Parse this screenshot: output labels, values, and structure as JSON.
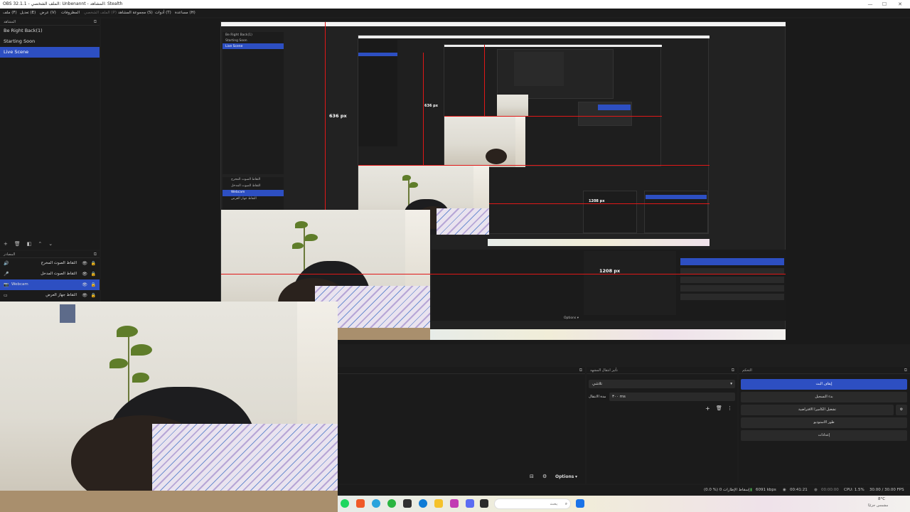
{
  "window": {
    "title": "OBS 32.1.1 - الملف الشخصي: Unbenannt - المشاهد: Stealth",
    "minimize": "—",
    "maximize": "☐",
    "close": "✕"
  },
  "menu": {
    "items": [
      "ملف (F)",
      "تعديل (E)",
      "عرض (V)",
      "المظروفات",
      "الملف الشخصي (P)",
      "مجموعة المشاهد (S)",
      "أدوات (T)",
      "مساعدة (H)"
    ]
  },
  "scenes": {
    "header": "المشاهد",
    "items": [
      "Be Right Back(1)",
      "Starting Soon",
      "Live Scene"
    ],
    "active_index": 2
  },
  "sources": {
    "header": "المصادر",
    "items": [
      {
        "label": "التقاط الصوت المخرج",
        "icon": "speaker-icon"
      },
      {
        "label": "التقاط الصوت المدخل",
        "icon": "microphone-icon"
      },
      {
        "label": "Webcam",
        "icon": "camera-icon"
      },
      {
        "label": "التقاط جهاز العرض",
        "icon": "monitor-icon"
      }
    ],
    "active_index": 2
  },
  "preview": {
    "height_label": "636 px",
    "width_label": "1208 px",
    "nested_height_label": "636 px",
    "nested_width_label": "1208 px",
    "nested_options": "Options ▾",
    "nested_scenes": [
      "Be Right Back(1)",
      "Starting Soon",
      "Live Scene"
    ],
    "nested_sources": [
      "التقاط الصوت المخرج",
      "التقاط الصوت المدخل",
      "Webcam",
      "التقاط جهاز العرض"
    ]
  },
  "transitions": {
    "header": "تأثير انتقال المشهد",
    "type": "تلاشي",
    "duration_label": "مدة الانتقال",
    "duration_value": "٣٠٠ ms"
  },
  "controls": {
    "header": "التحكم",
    "buttons": [
      "إيقاف البث",
      "بدء التسجيل",
      "تشغيل الكاميرا الافتراضية",
      "طور الاستوديو",
      "إعدادات"
    ]
  },
  "mixer": {
    "options": "Options"
  },
  "status": {
    "dropped": "(0.0 %) إسقاط الإطارات 0",
    "bitrate": "6091 kbps",
    "stream_time": "00:41:21",
    "rec_time": "00:00:00",
    "cpu": "CPU: 1.5%",
    "fps": "30.00 / 30.00 FPS"
  },
  "taskbar": {
    "search_placeholder": "بحث",
    "weather_temp": "8°C",
    "weather_desc": "مشمس جزئيًا"
  },
  "colors": {
    "accent": "#2d4fc2",
    "measure_red": "#e01818",
    "panel": "#1b1b1b"
  }
}
